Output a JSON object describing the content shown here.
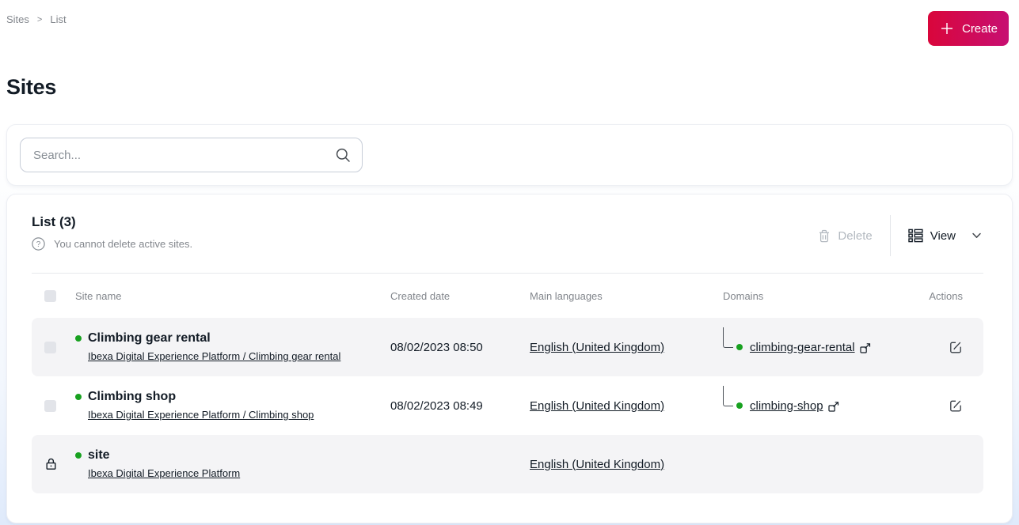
{
  "breadcrumb": {
    "items": [
      "Sites",
      "List"
    ],
    "separator": ">"
  },
  "header": {
    "create_label": "Create"
  },
  "page": {
    "title": "Sites"
  },
  "search": {
    "placeholder": "Search..."
  },
  "list": {
    "title": "List (3)",
    "hint": "You cannot delete active sites.",
    "toolbar": {
      "delete_label": "Delete",
      "view_label": "View"
    },
    "columns": {
      "site_name": "Site name",
      "created_date": "Created date",
      "main_languages": "Main languages",
      "domains": "Domains",
      "actions": "Actions"
    },
    "rows": [
      {
        "name": "Climbing gear rental",
        "path": "Ibexa Digital Experience Platform / Climbing gear rental",
        "created": "08/02/2023 08:50",
        "language": "English (United Kingdom)",
        "domain": "climbing-gear-rental",
        "status": "active"
      },
      {
        "name": "Climbing shop",
        "path": "Ibexa Digital Experience Platform / Climbing shop",
        "created": "08/02/2023 08:49",
        "language": "English (United Kingdom)",
        "domain": "climbing-shop",
        "status": "active"
      },
      {
        "name": "site",
        "path": "Ibexa Digital Experience Platform",
        "created": "",
        "language": "English (United Kingdom)",
        "domain": "",
        "status": "active",
        "locked": true
      }
    ]
  },
  "icons": {
    "create": "plus-icon",
    "search": "magnifier-icon",
    "delete": "trash-icon",
    "view": "list-view-icon",
    "view_dropdown": "chevron-down-icon",
    "hint": "question-circle-icon",
    "domain": "open-in-new-tab-icon",
    "row_action": "edit-icon",
    "locked_row": "lock-icon"
  },
  "colors": {
    "accent_gradient_start": "#d9063b",
    "accent_gradient_end": "#c70f72",
    "status_green": "#18a120",
    "row_stripe": "#f4f4f6"
  }
}
